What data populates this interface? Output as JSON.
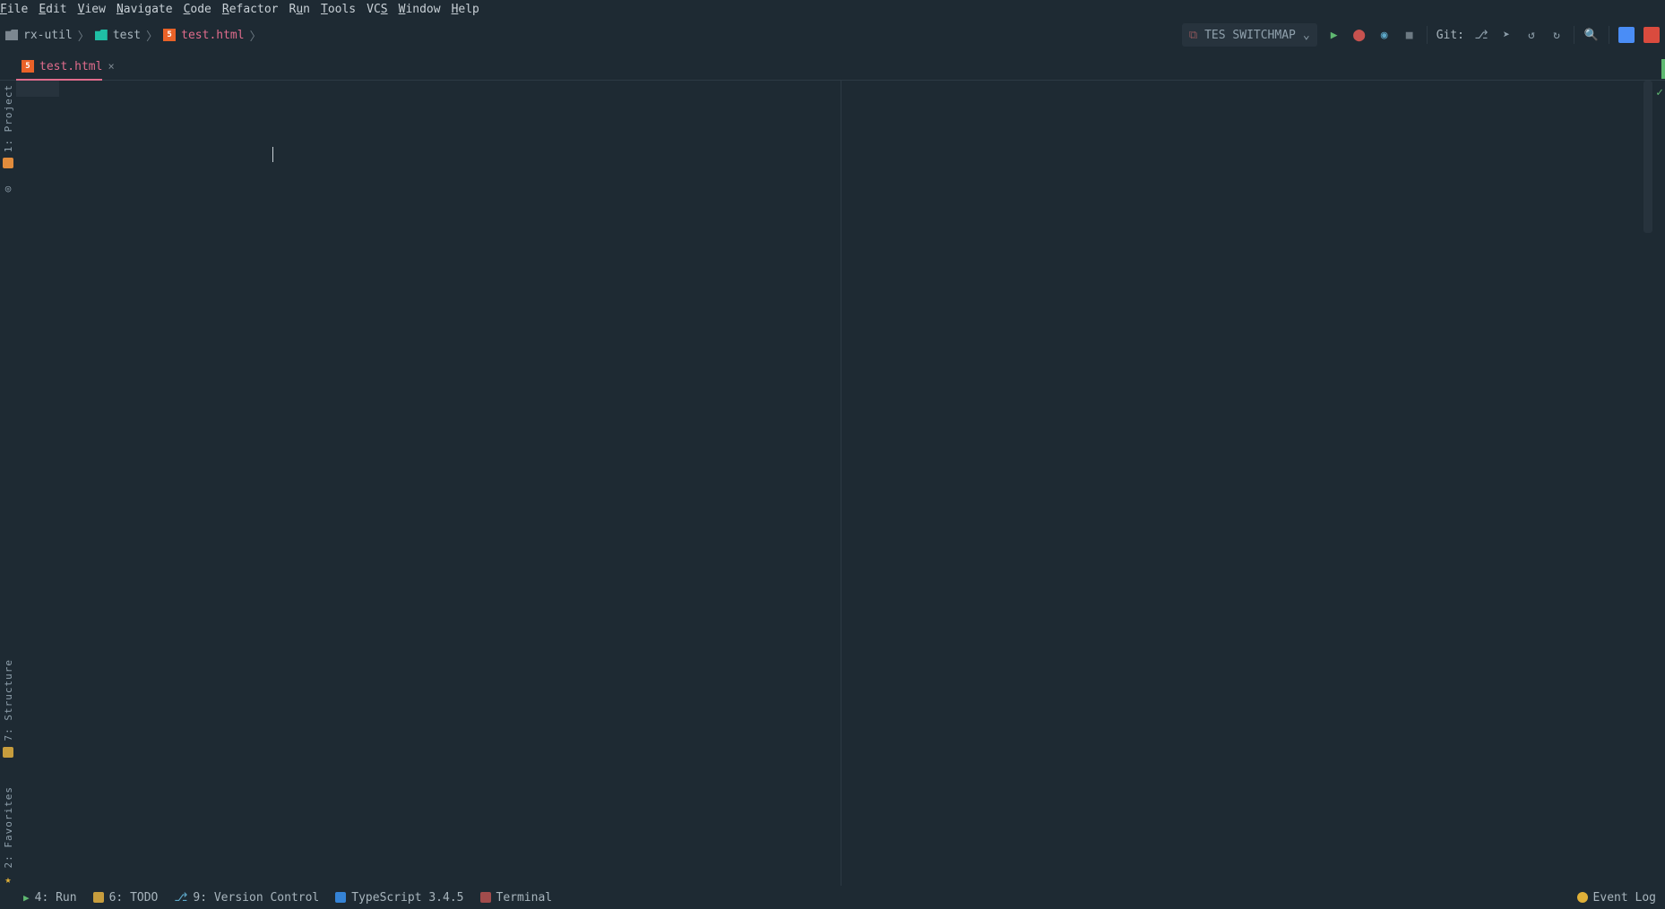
{
  "menu": {
    "file": "File",
    "edit": "Edit",
    "view": "View",
    "navigate": "Navigate",
    "code": "Code",
    "refactor": "Refactor",
    "run": "Run",
    "tools": "Tools",
    "vcs": "VCS",
    "window": "Window",
    "help": "Help"
  },
  "breadcrumb": {
    "root": "rx-util",
    "folder": "test",
    "file": "test.html"
  },
  "run_config": {
    "label": "TES SWITCHMAP"
  },
  "git": {
    "label": "Git:"
  },
  "tab": {
    "name": "test.html"
  },
  "left_tools": {
    "project": "1: Project",
    "structure": "7: Structure",
    "favorites": "2: Favorites"
  },
  "status": {
    "run": "4: Run",
    "todo": "6: TODO",
    "vc": "9: Version Control",
    "ts": "TypeScript 3.4.5",
    "terminal": "Terminal",
    "event_log": "Event Log"
  }
}
